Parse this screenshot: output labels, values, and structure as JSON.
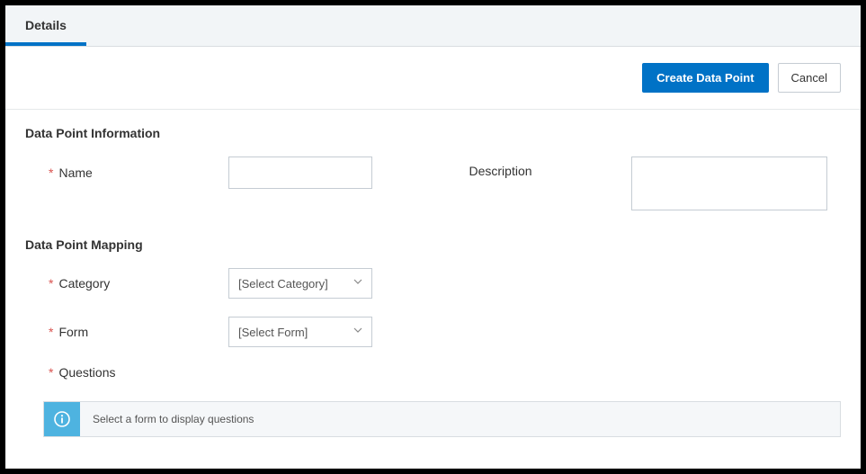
{
  "tabs": {
    "details": "Details"
  },
  "actions": {
    "create": "Create Data Point",
    "cancel": "Cancel"
  },
  "sections": {
    "info_title": "Data Point Information",
    "mapping_title": "Data Point Mapping"
  },
  "fields": {
    "name_label": "Name",
    "description_label": "Description",
    "category_label": "Category",
    "form_label": "Form",
    "questions_label": "Questions",
    "name_value": "",
    "description_value": "",
    "category_placeholder": "[Select Category]",
    "form_placeholder": "[Select Form]"
  },
  "banner": {
    "message": "Select a form to display questions"
  }
}
